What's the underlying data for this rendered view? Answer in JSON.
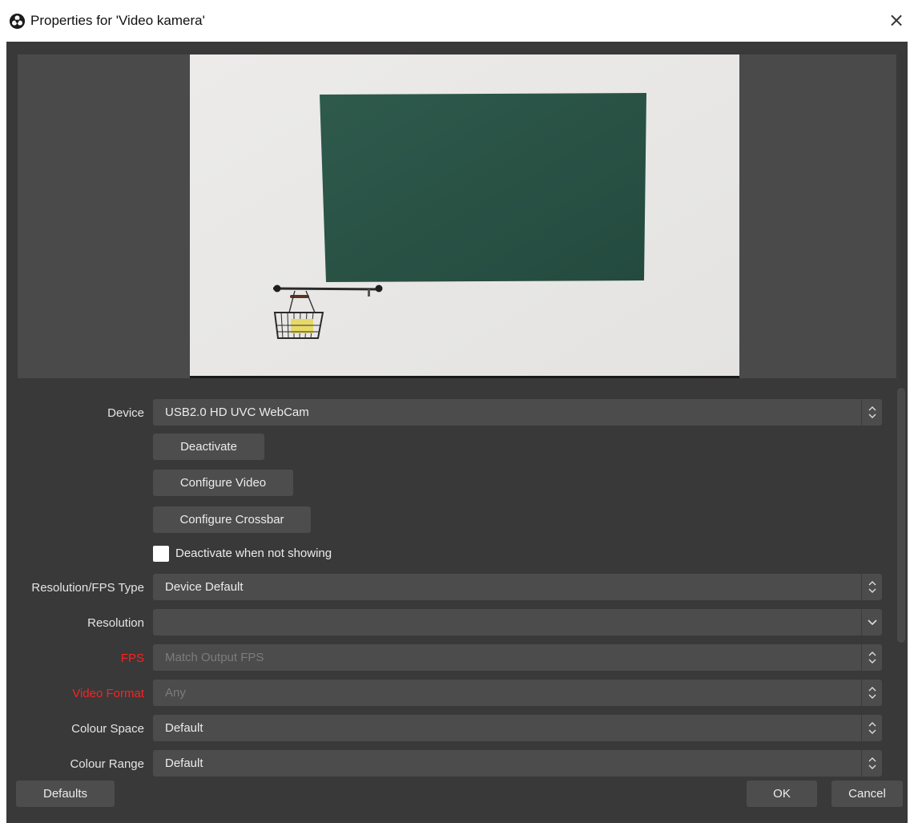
{
  "window": {
    "title": "Properties for 'Video kamera'",
    "close_glyph": "×",
    "app_icon": "obs-logo-icon"
  },
  "preview": {
    "description_icon": "camera-preview"
  },
  "form": {
    "device": {
      "label": "Device",
      "value": "USB2.0 HD UVC WebCam"
    },
    "buttons": {
      "deactivate": "Deactivate",
      "configure_video": "Configure Video",
      "configure_crossbar": "Configure Crossbar"
    },
    "deactivate_when_not_showing": {
      "label": "Deactivate when not showing",
      "checked": false
    },
    "resolution_fps_type": {
      "label": "Resolution/FPS Type",
      "value": "Device Default"
    },
    "resolution": {
      "label": "Resolution",
      "value": ""
    },
    "fps": {
      "label": "FPS",
      "value": "Match Output FPS",
      "disabled": true
    },
    "video_format": {
      "label": "Video Format",
      "value": "Any",
      "disabled": true
    },
    "colour_space": {
      "label": "Colour Space",
      "value": "Default"
    },
    "colour_range": {
      "label": "Colour Range",
      "value": "Default"
    }
  },
  "footer": {
    "defaults": "Defaults",
    "ok": "OK",
    "cancel": "Cancel"
  },
  "colors": {
    "dialog_bg": "#393939",
    "field_bg": "#4c4c4c",
    "error_label": "#ff2020"
  }
}
